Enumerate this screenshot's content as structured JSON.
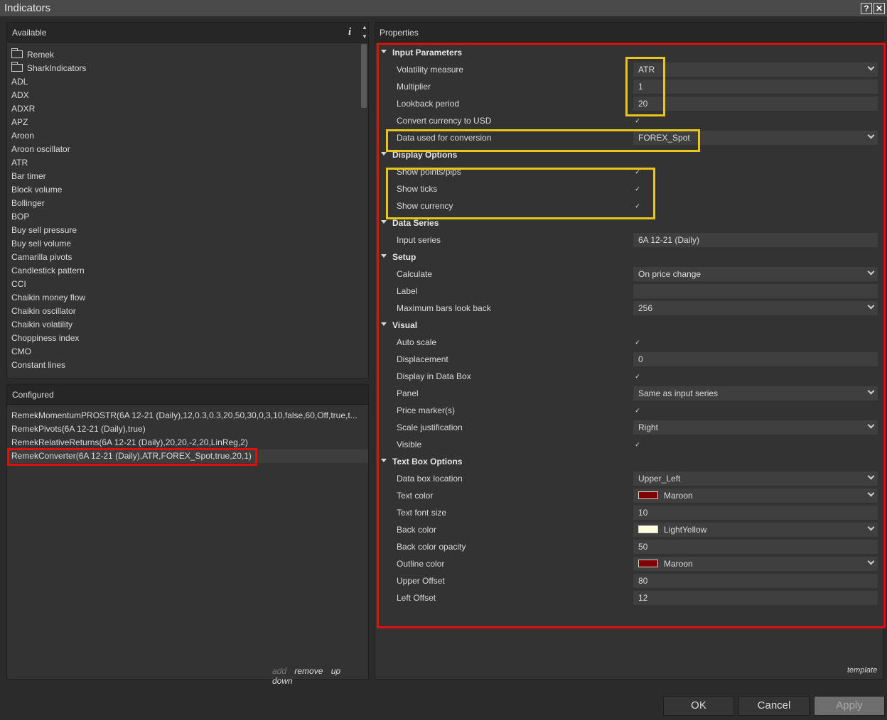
{
  "window": {
    "title": "Indicators",
    "help_icon": "?",
    "close_icon": "✕"
  },
  "available": {
    "header": "Available",
    "info_icon": "i",
    "folders": [
      "Remek",
      "SharkIndicators"
    ],
    "items": [
      "ADL",
      "ADX",
      "ADXR",
      "APZ",
      "Aroon",
      "Aroon oscillator",
      "ATR",
      "Bar timer",
      "Block volume",
      "Bollinger",
      "BOP",
      "Buy sell pressure",
      "Buy sell volume",
      "Camarilla pivots",
      "Candlestick pattern",
      "CCI",
      "Chaikin money flow",
      "Chaikin oscillator",
      "Chaikin volatility",
      "Choppiness index",
      "CMO",
      "Constant lines"
    ]
  },
  "configured": {
    "header": "Configured",
    "items": [
      "RemekMomentumPROSTR(6A 12-21 (Daily),12,0.3,0.3,20,50,30,0,3,10,false,60,Off,true,t...",
      "RemekPivots(6A 12-21 (Daily),true)",
      "RemekRelativeReturns(6A 12-21 (Daily),20,20,-2,20,LinReg,2)",
      "RemekConverter(6A 12-21 (Daily),ATR,FOREX_Spot,true,20,1)"
    ],
    "actions": {
      "add": "add",
      "remove": "remove",
      "up": "up",
      "down": "down"
    }
  },
  "properties": {
    "header": "Properties",
    "template_label": "template",
    "sections": [
      {
        "title": "Input Parameters",
        "rows": [
          {
            "label": "Volatility measure",
            "kind": "select",
            "value": "ATR"
          },
          {
            "label": "Multiplier",
            "kind": "text",
            "value": "1"
          },
          {
            "label": "Lookback period",
            "kind": "text",
            "value": "20"
          },
          {
            "label": "Convert currency to USD",
            "kind": "check",
            "value": "✓"
          },
          {
            "label": "Data used for conversion",
            "kind": "select",
            "value": "FOREX_Spot"
          }
        ]
      },
      {
        "title": "Display Options",
        "rows": [
          {
            "label": "Show points/pips",
            "kind": "check",
            "value": "✓"
          },
          {
            "label": "Show ticks",
            "kind": "check",
            "value": "✓"
          },
          {
            "label": "Show currency",
            "kind": "check",
            "value": "✓"
          }
        ]
      },
      {
        "title": "Data Series",
        "rows": [
          {
            "label": "Input series",
            "kind": "text",
            "value": "6A 12-21 (Daily)"
          }
        ]
      },
      {
        "title": "Setup",
        "rows": [
          {
            "label": "Calculate",
            "kind": "select",
            "value": "On price change"
          },
          {
            "label": "Label",
            "kind": "text",
            "value": ""
          },
          {
            "label": "Maximum bars look back",
            "kind": "select",
            "value": "256"
          }
        ]
      },
      {
        "title": "Visual",
        "rows": [
          {
            "label": "Auto scale",
            "kind": "check",
            "value": "✓"
          },
          {
            "label": "Displacement",
            "kind": "text",
            "value": "0"
          },
          {
            "label": "Display in Data Box",
            "kind": "check",
            "value": "✓"
          },
          {
            "label": "Panel",
            "kind": "select",
            "value": "Same as input series"
          },
          {
            "label": "Price marker(s)",
            "kind": "check",
            "value": "✓"
          },
          {
            "label": "Scale justification",
            "kind": "select",
            "value": "Right"
          },
          {
            "label": "Visible",
            "kind": "check",
            "value": "✓"
          }
        ]
      },
      {
        "title": "Text Box Options",
        "rows": [
          {
            "label": "Data box location",
            "kind": "select",
            "value": "Upper_Left"
          },
          {
            "label": "Text color",
            "kind": "color",
            "value": "Maroon",
            "color": "#800000"
          },
          {
            "label": "Text font size",
            "kind": "text",
            "value": "10"
          },
          {
            "label": "Back color",
            "kind": "color",
            "value": "LightYellow",
            "color": "#ffffe0"
          },
          {
            "label": "Back color opacity",
            "kind": "text",
            "value": "50"
          },
          {
            "label": "Outline color",
            "kind": "color",
            "value": "Maroon",
            "color": "#800000"
          },
          {
            "label": "Upper Offset",
            "kind": "text",
            "value": "80"
          },
          {
            "label": "Left Offset",
            "kind": "text",
            "value": "12"
          }
        ]
      }
    ]
  },
  "buttons": {
    "ok": "OK",
    "cancel": "Cancel",
    "apply": "Apply"
  },
  "colors": {
    "highlight_red": "#e01010",
    "highlight_yellow": "#e8c61a"
  }
}
